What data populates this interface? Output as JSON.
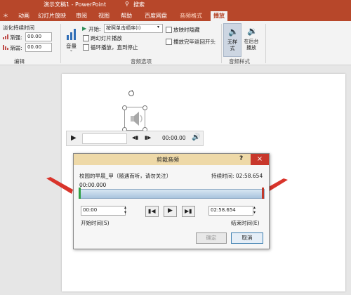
{
  "window": {
    "title_left": "演示文稿1 - PowerPoint",
    "search_label": "搜索"
  },
  "tabs": [
    "＊",
    "动画",
    "幻灯片放映",
    "审阅",
    "视图",
    "帮助",
    "百度网盘",
    "音频格式",
    "播放"
  ],
  "ribbon": {
    "fade_duration_label": "淡化持续时间",
    "fade_in_label": "渐强:",
    "fade_in_value": "00.00",
    "fade_out_label": "渐弱:",
    "fade_out_value": "00.00",
    "edit_group": "编辑",
    "volume_label": "音量",
    "start_label": "开始:",
    "start_value": "按照单击顺序(I)",
    "cross_slides": "跨幻灯片播放",
    "loop_until_stop": "循环播放，直到停止",
    "hide_during_show": "放映时隐藏",
    "rewind_after": "播放完毕返回开头",
    "audio_options_group": "音频选项",
    "no_style_label": "无样式",
    "bg_play_label": "在后台播放",
    "audio_styles_group": "音频样式"
  },
  "player": {
    "time": "00:00.00"
  },
  "dialog": {
    "title": "剪裁音频",
    "help": "?",
    "close": "×",
    "filename": "校园的早晨_甲（随遇而听，请勿关注）",
    "duration_label": "持续时间: 02:58.654",
    "position": "00:00.000",
    "start_time": "00:00",
    "end_time": "02:58.654",
    "start_label": "开始时间(S)",
    "end_label": "结束时间(E)",
    "ok": "确定",
    "cancel": "取消"
  },
  "colors": {
    "accent": "#b7472a",
    "arrow": "#d9342b",
    "start_marker": "#2ea043",
    "end_marker": "#c0392b"
  }
}
